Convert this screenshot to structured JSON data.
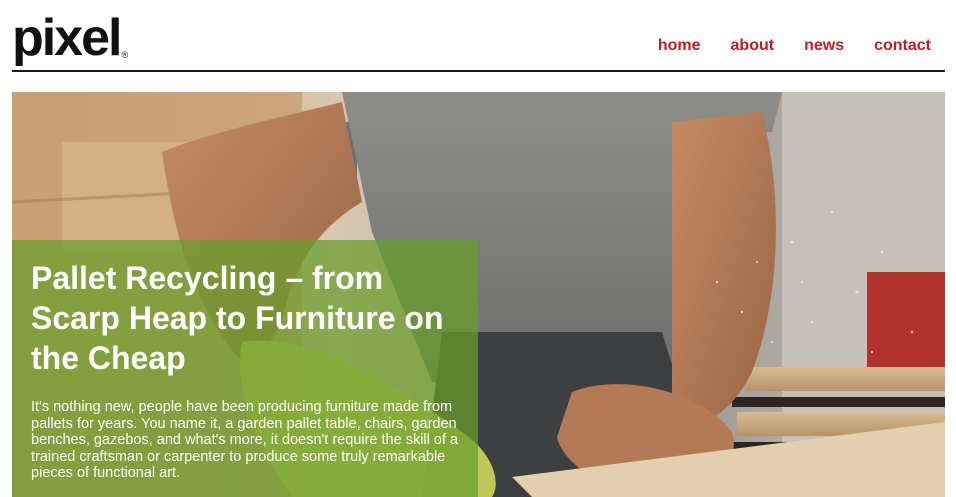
{
  "header": {
    "logo": "pixel",
    "logo_mark": "®",
    "nav": [
      {
        "label": "home"
      },
      {
        "label": "about"
      },
      {
        "label": "news"
      },
      {
        "label": "contact"
      }
    ]
  },
  "hero": {
    "image": "carpenter-sanding-wood-photo",
    "title": "Pallet Recycling – from Scarp Heap to Furniture on the Cheap",
    "body": "It's nothing new, people have been producing furniture made from pallets for years. You name it, a garden pallet table, chairs, garden benches, gazebos, and what's more, it doesn't require the skill of a trained craftsman or carpenter to produce some truly remarkable pieces of functional art."
  },
  "colors": {
    "nav_link": "#c21a21",
    "overlay": "#689e2a",
    "rule": "#1a1a1a"
  }
}
